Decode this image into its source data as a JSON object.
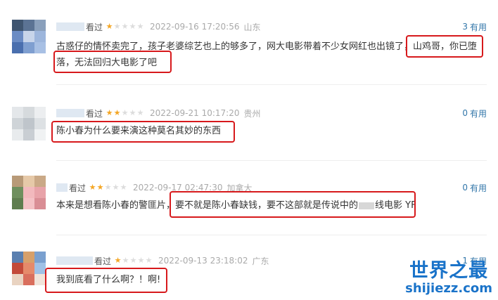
{
  "comments": [
    {
      "action": "看过",
      "rating": 1,
      "time": "2022-09-16 17:20:56",
      "location": "山东",
      "useful_count": "3",
      "useful_label": "有用",
      "text": "古惑仔的情怀卖完了，孩子老婆综艺也上的够多了，网大电影带着不少女网红也出镜了，山鸡哥，你已堕落，无法回归大电影了吧"
    },
    {
      "action": "看过",
      "rating": 2,
      "time": "2022-09-21 10:17:20",
      "location": "贵州",
      "useful_count": "0",
      "useful_label": "有用",
      "text": "陈小春为什么要来演这种莫名其妙的东西"
    },
    {
      "action": "看过",
      "rating": 2,
      "time": "2022-09-17 02:47:30",
      "location": "加拿大",
      "useful_count": "0",
      "useful_label": "有用",
      "text_before": "本来是想看陈小春的警匪片，要不就是陈小春缺钱，要不这部就是传说中的",
      "text_after": "线电影 YF"
    },
    {
      "action": "看过",
      "rating": 1,
      "time": "2022-09-13 23:18:02",
      "location": "广东",
      "useful_count": "1",
      "useful_label": "有用",
      "text": "我到底看了什么啊？！啊!"
    }
  ],
  "watermark": {
    "cn": "世界之最",
    "en": "shijiezz.com"
  },
  "colors": {
    "star": "#f4a624",
    "link": "#3377aa",
    "highlight": "#d7191c"
  }
}
